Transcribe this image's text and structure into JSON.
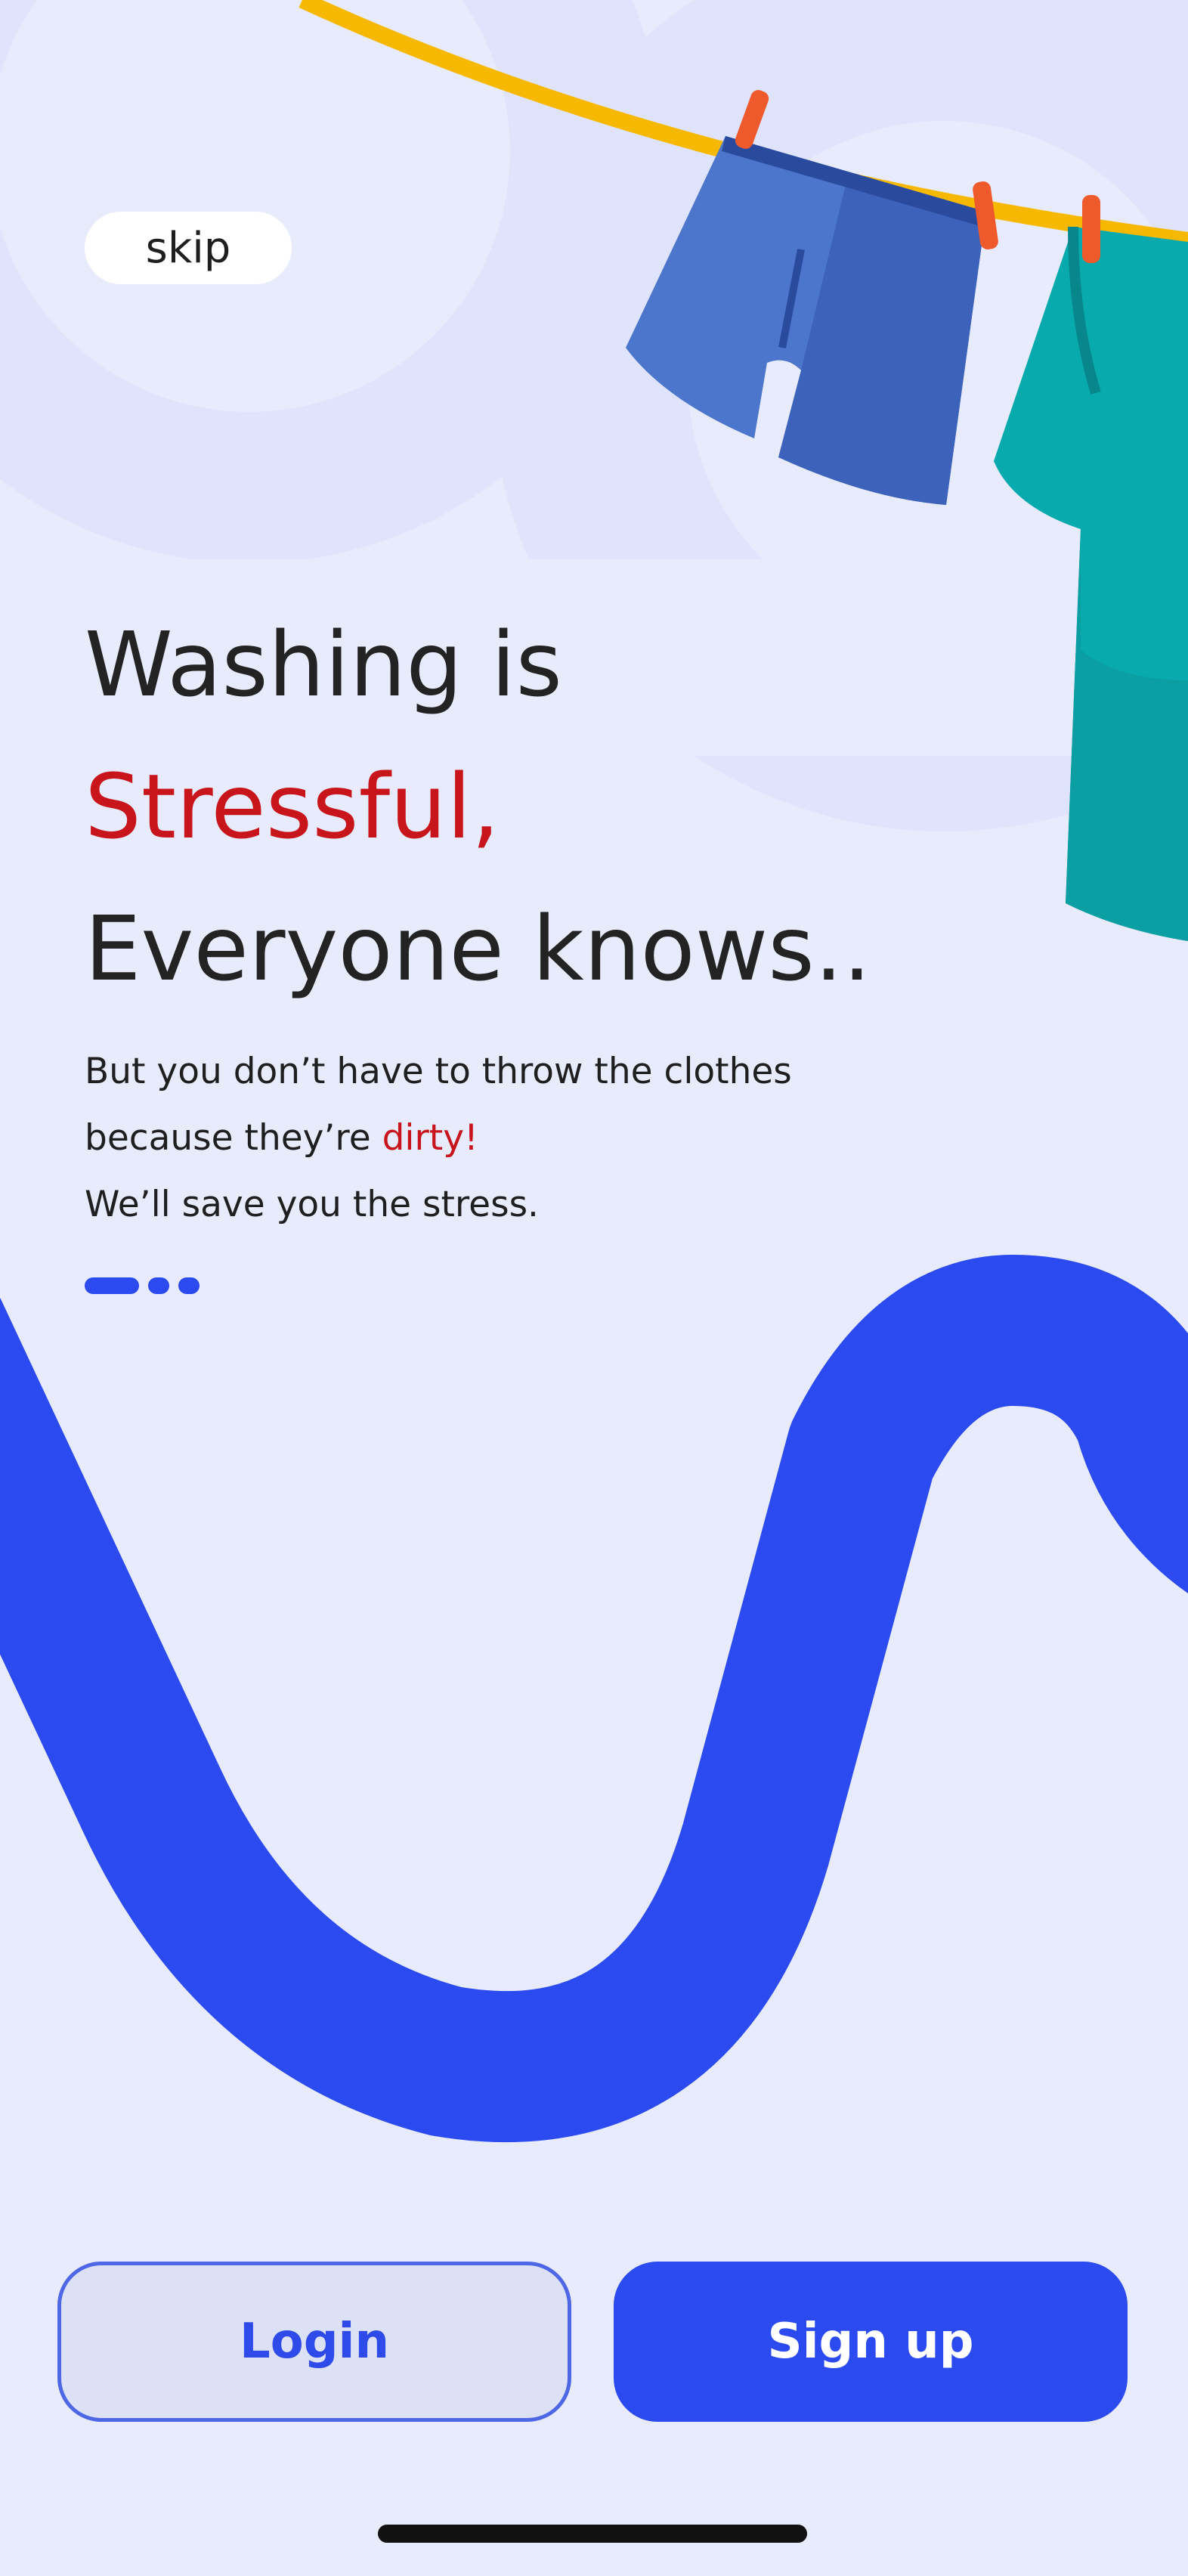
{
  "colors": {
    "background": "#e8ebfb",
    "accent": "#2b4af0",
    "highlight_red": "#c8141b",
    "text_dark": "#232323"
  },
  "header": {
    "skip_label": "skip"
  },
  "illustration": {
    "icons": [
      "clothesline-icon",
      "shorts-icon",
      "tshirt-icon",
      "clothes-peg-icon"
    ]
  },
  "onboarding": {
    "headline_line1": "Washing is",
    "headline_line2": "Stressful,",
    "headline_line3": "Everyone knows..",
    "body_line1": "But you don’t have to throw the clothes",
    "body_line2_prefix": "because they’re ",
    "body_line2_highlight": "dirty!",
    "body_line3": "We’ll save you the stress.",
    "page_count": 3,
    "current_page": 1
  },
  "actions": {
    "login_label": "Login",
    "signup_label": "Sign up"
  }
}
